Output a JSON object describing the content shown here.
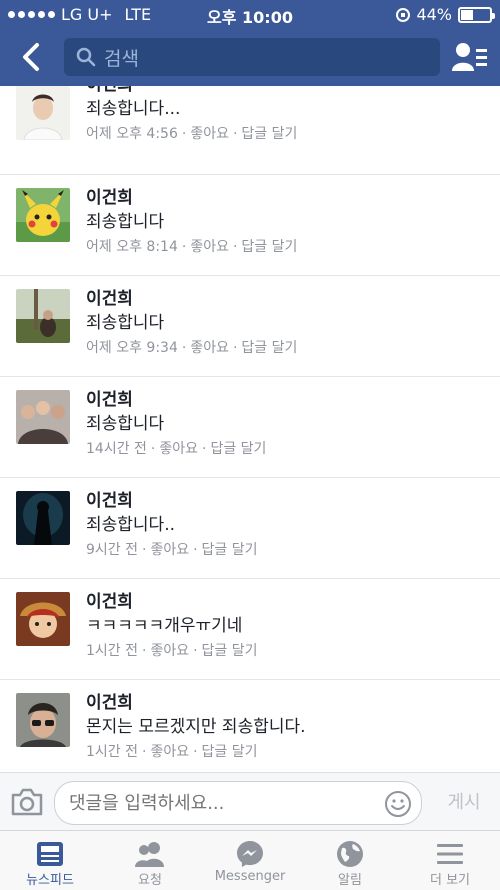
{
  "status": {
    "carrier": "LG U+",
    "network": "LTE",
    "time": "오후 10:00",
    "battery": "44%",
    "battery_level": 0.44
  },
  "nav": {
    "search_placeholder": "검색"
  },
  "comments": [
    {
      "name": "이건희",
      "text": "죄송합니다...",
      "time": "어제 오후 4:56",
      "like": "좋아요",
      "reply": "답글 달기",
      "avatar": "profile-photo"
    },
    {
      "name": "이건희",
      "text": "죄송합니다",
      "time": "어제 오후 8:14",
      "like": "좋아요",
      "reply": "답글 달기",
      "avatar": "pikachu"
    },
    {
      "name": "이건희",
      "text": "죄송합니다",
      "time": "어제 오후 9:34",
      "like": "좋아요",
      "reply": "답글 달기",
      "avatar": "outdoor-photo"
    },
    {
      "name": "이건희",
      "text": "죄송합니다",
      "time": "14시간 전",
      "like": "좋아요",
      "reply": "답글 달기",
      "avatar": "group-photo"
    },
    {
      "name": "이건희",
      "text": "죄송합니다..",
      "time": "9시간 전",
      "like": "좋아요",
      "reply": "답글 달기",
      "avatar": "dark-figure"
    },
    {
      "name": "이건희",
      "text": "ㅋㅋㅋㅋㅋ개우ㅠ기네",
      "time": "1시간 전",
      "like": "좋아요",
      "reply": "답글 달기",
      "avatar": "anime-character"
    },
    {
      "name": "이건희",
      "text": "몬지는 모르겠지만 죄송합니다.",
      "time": "1시간 전",
      "like": "좋아요",
      "reply": "답글 달기",
      "avatar": "selfie"
    }
  ],
  "composer": {
    "placeholder": "댓글을 입력하세요...",
    "post_label": "게시"
  },
  "tabs": [
    {
      "label": "뉴스피드",
      "icon": "newsfeed-icon",
      "active": true
    },
    {
      "label": "요청",
      "icon": "friend-requests-icon",
      "active": false
    },
    {
      "label": "Messenger",
      "icon": "messenger-icon",
      "active": false
    },
    {
      "label": "알림",
      "icon": "globe-notifications-icon",
      "active": false
    },
    {
      "label": "더 보기",
      "icon": "menu-icon",
      "active": false
    }
  ],
  "colors": {
    "brand": "#3b5998",
    "meta_text": "#90949c",
    "inactive_tab": "#90949c"
  }
}
